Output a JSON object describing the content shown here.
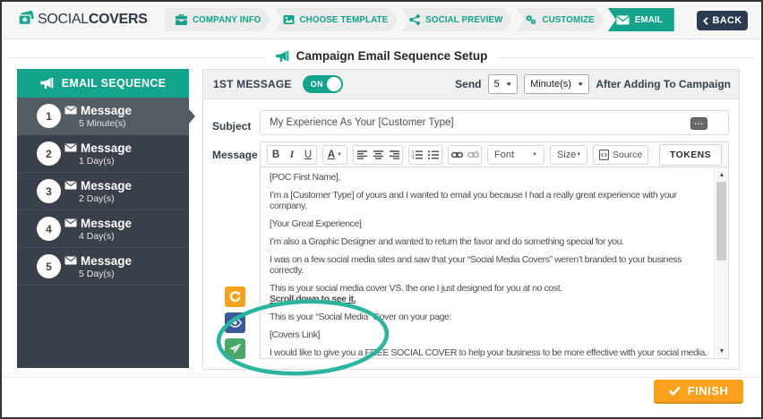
{
  "brand": {
    "name_regular": "SOCIAL",
    "name_bold": "COVERS"
  },
  "wizard": {
    "steps": [
      {
        "label": "COMPANY INFO",
        "icon": "briefcase",
        "active": false
      },
      {
        "label": "CHOOSE TEMPLATE",
        "icon": "image",
        "active": false
      },
      {
        "label": "SOCIAL PREVIEW",
        "icon": "share",
        "active": false
      },
      {
        "label": "CUSTOMIZE",
        "icon": "gears",
        "active": false
      },
      {
        "label": "EMAIL",
        "icon": "envelope",
        "active": true
      }
    ],
    "back_label": "BACK"
  },
  "page_heading": {
    "title": "Campaign Email Sequence Setup"
  },
  "sidebar": {
    "header": "EMAIL SEQUENCE",
    "items": [
      {
        "number": "1",
        "title": "Message",
        "subtitle": "5 Minute(s)",
        "active": true
      },
      {
        "number": "2",
        "title": "Message",
        "subtitle": "1 Day(s)",
        "active": false
      },
      {
        "number": "3",
        "title": "Message",
        "subtitle": "2 Day(s)",
        "active": false
      },
      {
        "number": "4",
        "title": "Message",
        "subtitle": "4 Day(s)",
        "active": false
      },
      {
        "number": "5",
        "title": "Message",
        "subtitle": "5 Day(s)",
        "active": false
      }
    ]
  },
  "message_panel": {
    "header": {
      "label": "1ST MESSAGE",
      "toggle_state": "ON",
      "send_label": "Send",
      "delay_value": "5",
      "delay_unit": "Minute(s)",
      "after_label": "After Adding To Campaign"
    },
    "subject": {
      "label": "Subject",
      "value": "My Experience As Your [Customer Type]"
    },
    "message": {
      "label": "Message",
      "toolbar": {
        "font_label": "Font",
        "size_label": "Size",
        "source_label": "Source",
        "tokens_label": "TOKENS"
      },
      "paragraphs": [
        {
          "text": "[POC First Name],"
        },
        {
          "text": "I’m a [Customer Type] of yours and I wanted to email you because I had a really great experience with your company."
        },
        {
          "text": "[Your Great Experience]"
        },
        {
          "text": "I’m also a Graphic Designer and wanted to return the favor and do something special for you."
        },
        {
          "text": "I was on a few social media sites and saw that your “Social Media Covers” weren’t branded to your business correctly."
        },
        {
          "text": "This is your social media cover VS. the one I just designed for you at no cost.",
          "emphasis": "Scroll down to see it."
        },
        {
          "text": "This is your “Social Media” Cover on your page:"
        },
        {
          "text": "[Covers Link]"
        },
        {
          "text": "I would like to give you a FREE SOCIAL COVER to help your business to be more effective with your social media."
        }
      ]
    }
  },
  "footer": {
    "finish_label": "FINISH"
  },
  "colors": {
    "teal": "#14a48c",
    "sidebar_dark": "#3a4049",
    "sidebar_active": "#535b63",
    "navy": "#2c3b4f",
    "orange_button": "#f6a21d",
    "blue_button": "#3a5a9c",
    "green_button": "#4aa768",
    "finish_orange": "#f9a11c",
    "annotation_teal": "#2bb4a0"
  }
}
